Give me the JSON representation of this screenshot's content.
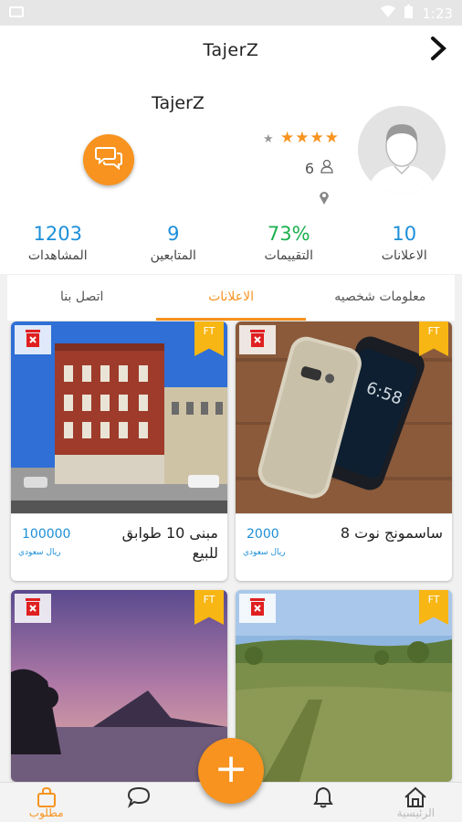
{
  "statusbar": {
    "time": "1:23"
  },
  "appbar": {
    "title": "TajerZ"
  },
  "profile": {
    "name": "TajerZ",
    "followers_count": "6"
  },
  "stats": [
    {
      "value": "10",
      "label": "الاعلانات",
      "color": "#1c8fd8"
    },
    {
      "value": "73%",
      "label": "التقييمات",
      "color": "#1bb04e"
    },
    {
      "value": "9",
      "label": "المتابعين",
      "color": "#1c8fd8"
    },
    {
      "value": "1203",
      "label": "المشاهدات",
      "color": "#1c8fd8"
    }
  ],
  "tabs": [
    {
      "label": "معلومات شخصيه",
      "active": false
    },
    {
      "label": "الاعلانات",
      "active": true
    },
    {
      "label": "اتصل بنا",
      "active": false
    }
  ],
  "listings": [
    {
      "title": "ساسمونج نوت 8",
      "price": "2000",
      "currency": "ريال سعودي",
      "badge": "FT"
    },
    {
      "title": "مبنى 10 طوابق للبيع",
      "price": "100000",
      "currency": "ريال سعودي",
      "badge": "FT"
    },
    {
      "badge": "FT"
    },
    {
      "badge": "FT"
    }
  ],
  "bottomnav": [
    {
      "label": "الرئيسية",
      "icon": "home-icon"
    },
    {
      "label": "",
      "icon": "bell-icon"
    },
    {
      "label": "",
      "icon": "add-icon"
    },
    {
      "label": "",
      "icon": "chat-icon"
    },
    {
      "label": "مطلوب",
      "icon": "wanted-icon"
    }
  ],
  "colors": {
    "accent": "#f7931e",
    "blue": "#1c8fd8",
    "green": "#1bb04e",
    "badge": "#f7b614"
  }
}
